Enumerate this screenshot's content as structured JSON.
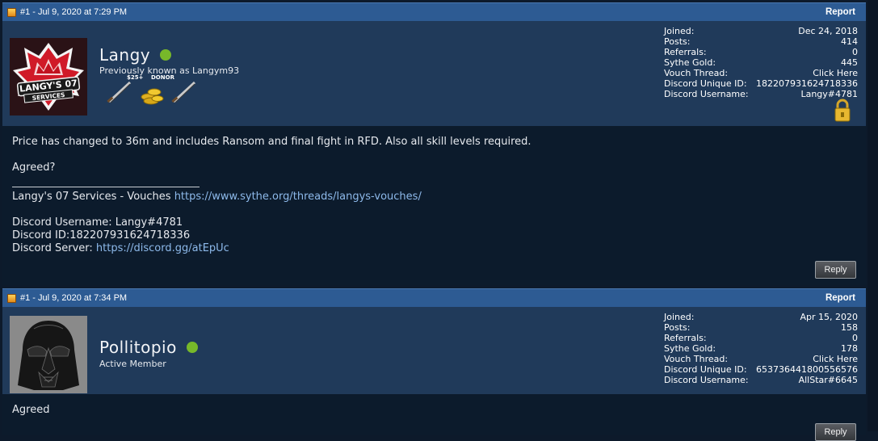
{
  "posts": [
    {
      "header": "#1 - Jul 9, 2020 at 7:29 PM",
      "report": "Report",
      "username": "Langy",
      "usertitle": "Previously known as Langym93",
      "donor_top": "$25+",
      "donor_label": "DONOR",
      "avatar_text_1": "LANGY'S 07",
      "avatar_text_2": "SERVICES",
      "stats": [
        {
          "label": "Joined:",
          "value": "Dec 24, 2018"
        },
        {
          "label": "Posts:",
          "value": "414"
        },
        {
          "label": "Referrals:",
          "value": "0"
        },
        {
          "label": "Sythe Gold:",
          "value": "445"
        },
        {
          "label": "Vouch Thread:",
          "value": "Click Here"
        },
        {
          "label": "Discord Unique ID:",
          "value": "182207931624718336"
        },
        {
          "label": "Discord Username:",
          "value": "Langy#4781"
        }
      ],
      "message": {
        "line1": "Price has changed to 36m and includes Ransom and final fight in RFD. Also all skill levels required.",
        "line2": "Agreed?",
        "sig_prefix": "Langy's 07 Services - Vouches ",
        "sig_link": "https://www.sythe.org/threads/langys-vouches/",
        "discord_username": "Discord Username: Langy#4781",
        "discord_id": "Discord ID:182207931624718336",
        "server_prefix": "Discord Server: ",
        "server_link": "https://discord.gg/atEpUc"
      },
      "reply": "Reply"
    },
    {
      "header": "#1 - Jul 9, 2020 at 7:34 PM",
      "report": "Report",
      "username": "Pollitopio",
      "usertitle": "Active Member",
      "stats": [
        {
          "label": "Joined:",
          "value": "Apr 15, 2020"
        },
        {
          "label": "Posts:",
          "value": "158"
        },
        {
          "label": "Referrals:",
          "value": "0"
        },
        {
          "label": "Sythe Gold:",
          "value": "178"
        },
        {
          "label": "Vouch Thread:",
          "value": "Click Here"
        },
        {
          "label": "Discord Unique ID:",
          "value": "653736441800556576"
        },
        {
          "label": "Discord Username:",
          "value": "AllStar#6645"
        }
      ],
      "message": {
        "line1": "Agreed"
      },
      "reply": "Reply"
    }
  ],
  "colors": {
    "header_bar": "#2d5b93",
    "userbar": "#203a5a",
    "message_bg": "#0c1b2c",
    "link": "#8db9ea",
    "online": "#77b82a"
  }
}
